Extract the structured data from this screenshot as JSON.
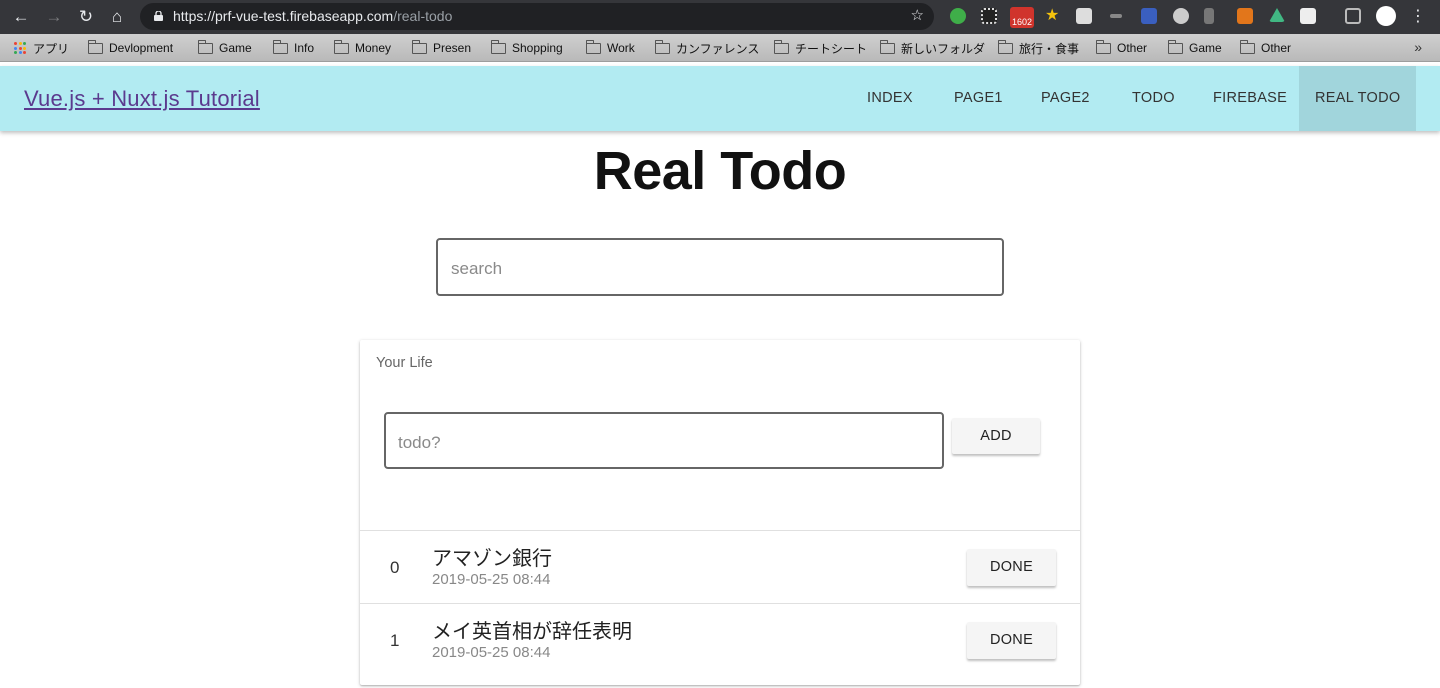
{
  "browser": {
    "url_host": "https://prf-vue-test.firebaseapp.com",
    "url_path": "/real-todo",
    "gmail_badge": "1602",
    "bookmarks": [
      {
        "label": "アプリ",
        "type": "apps"
      },
      {
        "label": "Devlopment",
        "type": "folder"
      },
      {
        "label": "Game",
        "type": "folder"
      },
      {
        "label": "Info",
        "type": "folder"
      },
      {
        "label": "Money",
        "type": "folder"
      },
      {
        "label": "Presen",
        "type": "folder"
      },
      {
        "label": "Shopping",
        "type": "folder"
      },
      {
        "label": "Work",
        "type": "folder"
      },
      {
        "label": "カンファレンス",
        "type": "folder"
      },
      {
        "label": "チートシート",
        "type": "folder"
      },
      {
        "label": "新しいフォルダ",
        "type": "folder"
      },
      {
        "label": "旅行・食事",
        "type": "folder"
      },
      {
        "label": "Other",
        "type": "folder"
      },
      {
        "label": "Game",
        "type": "folder"
      },
      {
        "label": "Other",
        "type": "folder"
      }
    ]
  },
  "header": {
    "brand": "Vue.js + Nuxt.js Tutorial",
    "nav": [
      "INDEX",
      "PAGE1",
      "PAGE2",
      "TODO",
      "FIREBASE",
      "REAL TODO"
    ],
    "active_nav": "REAL TODO"
  },
  "main": {
    "title": "Real Todo",
    "search_placeholder": "search",
    "card": {
      "title": "Your Life",
      "todo_placeholder": "todo?",
      "add_label": "ADD",
      "items": [
        {
          "index": "0",
          "title": "アマゾン銀行",
          "date": "2019-05-25 08:44",
          "action": "DONE"
        },
        {
          "index": "1",
          "title": "メイ英首相が辞任表明",
          "date": "2019-05-25 08:44",
          "action": "DONE"
        }
      ]
    }
  },
  "colors": {
    "header_bg": "#b2ebf2",
    "active_nav_bg": "#a1d5dc",
    "brand_link": "#5b3a8e"
  }
}
